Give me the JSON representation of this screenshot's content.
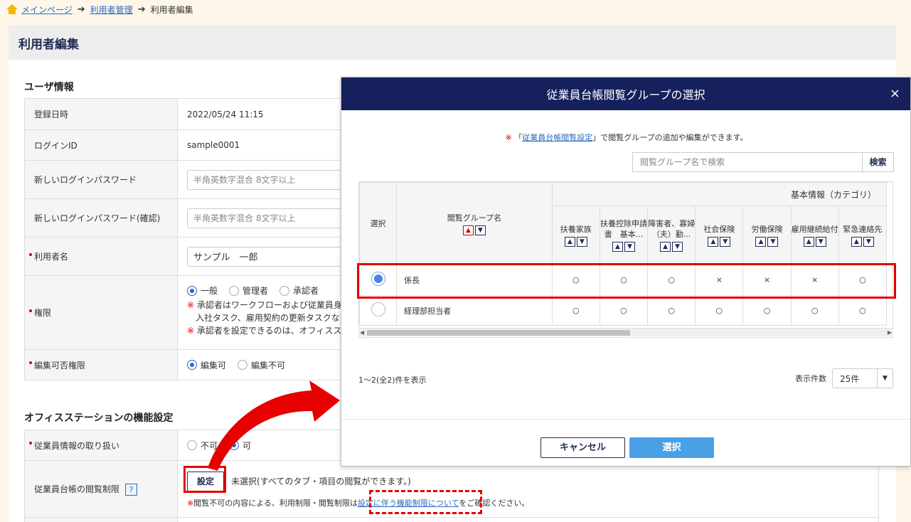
{
  "breadcrumb": {
    "home": "メインページ",
    "level2": "利用者管理",
    "current": "利用者編集"
  },
  "page_title": "利用者編集",
  "user_info": {
    "section_title": "ユーザ情報",
    "rows": {
      "registered_label": "登録日時",
      "registered_value": "2022/05/24 11:15",
      "login_id_label": "ログインID",
      "login_id_value": "sample0001",
      "new_password_label": "新しいログインパスワード",
      "new_password_placeholder": "半角英数字混合 8文字以上",
      "confirm_password_label": "新しいログインパスワード(確認)",
      "confirm_password_placeholder": "半角英数字混合 8文字以上",
      "user_name_label": "利用者名",
      "user_name_value": "サンプル　一郎",
      "role_label": "権限",
      "role_options": [
        "一般",
        "管理者",
        "承認者"
      ],
      "role_note1_a": "※",
      "role_note1_b": " 承認者はワークフローおよび従業員身",
      "role_note1_c": "入社タスク、雇用契約の更新タスクな",
      "role_note2_a": "※",
      "role_note2_b": " 承認者を設定できるのは、オフィスス",
      "edit_label": "編集可否権限",
      "edit_options": [
        "編集可",
        "編集不可"
      ]
    }
  },
  "office_station": {
    "section_title": "オフィスステーションの機能設定",
    "employee_info_label": "従業員情報の取り扱い",
    "employee_info_options": [
      "不可",
      "可"
    ],
    "ledger_label": "従業員台帳の閲覧制限",
    "help_icon": "?",
    "set_button": "設定",
    "ledger_status": "未選択(すべてのタブ・項目の閲覧ができます。)",
    "ledger_note_mark": "※",
    "ledger_note_before": "閲覧不可の内容による、利用制限・閲覧制限は",
    "ledger_note_link": "設定に伴う機能制限について",
    "ledger_note_after": "をご確認ください。"
  },
  "modal": {
    "title": "従業員台帳閲覧グループの選択",
    "close": "×",
    "note_mark": "※",
    "note_open": "「",
    "note_link": "従業員台帳閲覧設定",
    "note_rest": "」で閲覧グループの追加や編集ができます。",
    "search_placeholder": "閲覧グループ名で検索",
    "search_button": "検索",
    "col_select": "選択",
    "col_group": "閲覧グループ名",
    "category_header": "基本情報（カテゴリ）",
    "categories": [
      "扶養家族",
      "扶養控除申請書　基本...",
      "障害者、寡婦（夫）勤...",
      "社会保険",
      "労働保険",
      "雇用継続給付",
      "緊急連絡先"
    ],
    "rows": [
      {
        "name": "係長",
        "selected": true,
        "values": [
          "○",
          "○",
          "○",
          "×",
          "×",
          "×",
          "○"
        ]
      },
      {
        "name": "経理部担当者",
        "selected": false,
        "values": [
          "○",
          "○",
          "○",
          "○",
          "○",
          "○",
          "○"
        ]
      }
    ],
    "count_text": "1〜2(全2)件を表示",
    "per_page_label": "表示件数",
    "per_page_value": "25件",
    "cancel_button": "キャンセル",
    "select_button": "選択"
  },
  "colors": {
    "navy": "#15205c",
    "link": "#2a6ac0",
    "highlight_red": "#e60000",
    "primary_button": "#4aa0e6"
  }
}
